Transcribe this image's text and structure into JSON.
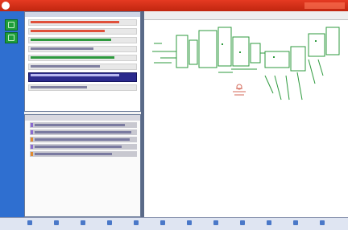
{
  "window": {
    "title": ""
  },
  "sidebar": {
    "buttons": [
      {
        "icon": "green-app-icon"
      },
      {
        "icon": "green-app-icon"
      }
    ]
  },
  "list_pane": {
    "header": "",
    "rows": [
      {
        "kind": "red",
        "label": ""
      },
      {
        "kind": "red",
        "label": ""
      },
      {
        "kind": "green",
        "label": ""
      },
      {
        "kind": "default",
        "label": ""
      },
      {
        "kind": "green",
        "label": ""
      },
      {
        "kind": "default",
        "label": ""
      },
      {
        "kind": "selected",
        "label": ""
      },
      {
        "kind": "default",
        "label": ""
      }
    ]
  },
  "detail_pane": {
    "header": "",
    "rows": [
      {
        "tag": "purple",
        "label": ""
      },
      {
        "tag": "purple",
        "label": ""
      },
      {
        "tag": "orange",
        "label": ""
      },
      {
        "tag": "purple",
        "label": ""
      },
      {
        "tag": "orange",
        "label": ""
      }
    ]
  },
  "diagram": {
    "tabs": [
      "",
      ""
    ]
  },
  "taskbar": {
    "buttons": [
      {
        "icon": "app-icon",
        "label": ""
      },
      {
        "icon": "app-icon",
        "label": ""
      },
      {
        "icon": "app-icon",
        "label": ""
      },
      {
        "icon": "app-icon",
        "label": ""
      },
      {
        "icon": "app-icon",
        "label": ""
      },
      {
        "icon": "app-icon",
        "label": ""
      },
      {
        "icon": "app-icon",
        "label": ""
      },
      {
        "icon": "app-icon",
        "label": ""
      },
      {
        "icon": "app-icon",
        "label": ""
      },
      {
        "icon": "app-icon",
        "label": ""
      },
      {
        "icon": "app-icon",
        "label": ""
      },
      {
        "icon": "app-icon",
        "label": ""
      }
    ]
  },
  "colors": {
    "titlebar": "#d6321a",
    "sidebar": "#2f6fd0",
    "accent_green": "#1e9e3a",
    "selection": "#2b2a8c",
    "diagram_green": "#2e9a3e"
  }
}
